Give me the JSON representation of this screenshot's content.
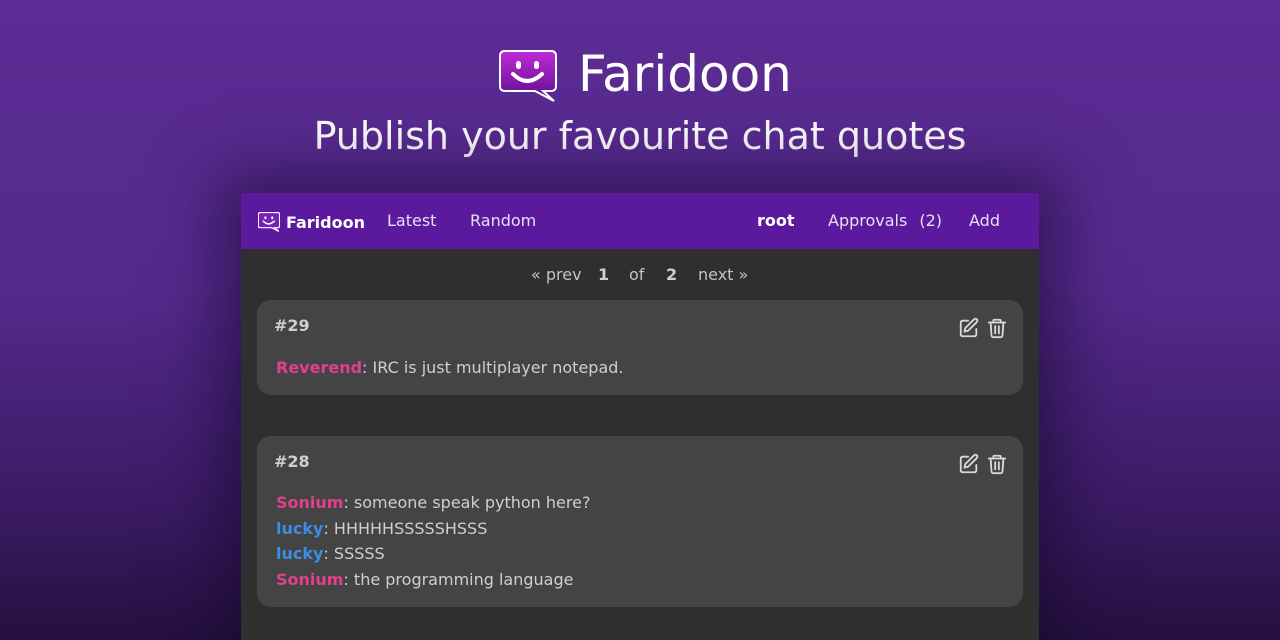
{
  "colors": {
    "accent_purple": "#5b1a9e",
    "nick_pink": "#e0408e",
    "nick_blue": "#3a8ee8",
    "card_bg": "#444444",
    "app_bg": "#2f2f2f"
  },
  "hero": {
    "logo_icon": "smiley-speech-bubble-icon",
    "title": "Faridoon",
    "subtitle": "Publish your favourite chat quotes"
  },
  "navbar": {
    "brand_icon": "smiley-speech-bubble-icon",
    "brand": "Faridoon",
    "links": {
      "latest": "Latest",
      "random": "Random"
    },
    "user": "root",
    "approvals_label": "Approvals",
    "approvals_count": "(2)",
    "add": "Add"
  },
  "pagination": {
    "prev": "« prev",
    "current": "1",
    "of": "of",
    "total": "2",
    "next": "next »"
  },
  "quotes": [
    {
      "id": "#29",
      "lines": [
        {
          "nick": "Reverend",
          "text": ": IRC is just multiplayer notepad."
        }
      ]
    },
    {
      "id": "#28",
      "lines": [
        {
          "nick": "Sonium",
          "text": ": someone speak python here?"
        },
        {
          "nick": "lucky",
          "text": ": HHHHHSSSSSHSSS"
        },
        {
          "nick": "lucky",
          "text": ": SSSSS"
        },
        {
          "nick": "Sonium",
          "text": ": the programming language"
        }
      ]
    }
  ],
  "icons": {
    "edit": "edit-pencil-icon",
    "delete": "trash-icon"
  }
}
